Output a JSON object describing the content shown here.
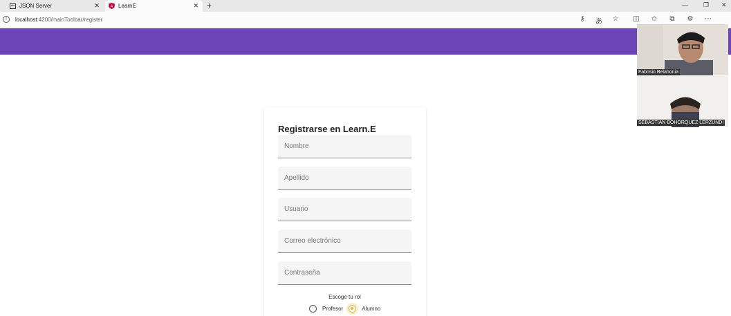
{
  "browser": {
    "tabs": [
      {
        "label": "JSON Server",
        "icon": "json-tab-icon"
      },
      {
        "label": "LearnE",
        "icon": "angular-icon"
      }
    ],
    "new_tab": "+",
    "url_host": "localhost",
    "url_path": ":4200/mainToolbar/register"
  },
  "register": {
    "title": "Registrarse en Learn.E",
    "fields": [
      {
        "placeholder": "Nombre"
      },
      {
        "placeholder": "Apellido"
      },
      {
        "placeholder": "Usuario"
      },
      {
        "placeholder": "Correo electrónico"
      },
      {
        "placeholder": "Contraseña"
      }
    ],
    "role_label": "Escoge tu rol",
    "roles": [
      {
        "label": "Profesor",
        "selected": false
      },
      {
        "label": "Alumno",
        "selected": true
      }
    ]
  },
  "video_call": {
    "participants": [
      {
        "name": "Fabrisio Belahonia"
      },
      {
        "name": "SEBASTIAN BOHORQUEZ LERZUNDI"
      }
    ]
  },
  "colors": {
    "appbar": "#6b45b8",
    "radio_accent": "#e8b93a"
  }
}
